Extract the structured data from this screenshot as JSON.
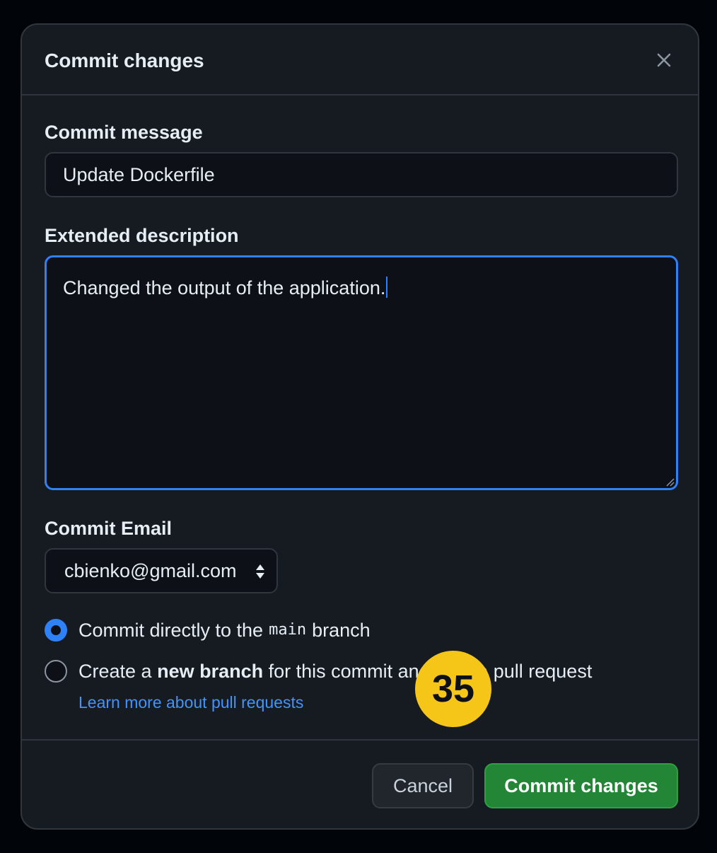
{
  "dialog": {
    "title": "Commit changes",
    "close_icon": "close-icon"
  },
  "form": {
    "message_label": "Commit message",
    "message_value": "Update Dockerfile",
    "description_label": "Extended description",
    "description_value": "Changed the output of the application.",
    "email_label": "Commit Email",
    "email_value": "cbienko@gmail.com"
  },
  "options": {
    "direct_prefix": "Commit directly to the",
    "direct_branch": "main",
    "direct_suffix": "branch",
    "new_prefix": "Create a",
    "new_bold": "new branch",
    "new_suffix": "for this commit and start a pull request",
    "learn_more": "Learn more about pull requests",
    "selected": "direct"
  },
  "badge": {
    "number": "35",
    "color": "#f5c518"
  },
  "footer": {
    "cancel_label": "Cancel",
    "commit_label": "Commit changes"
  },
  "colors": {
    "accent": "#2f81f7",
    "primary_button": "#238636",
    "link": "#4493f8"
  }
}
